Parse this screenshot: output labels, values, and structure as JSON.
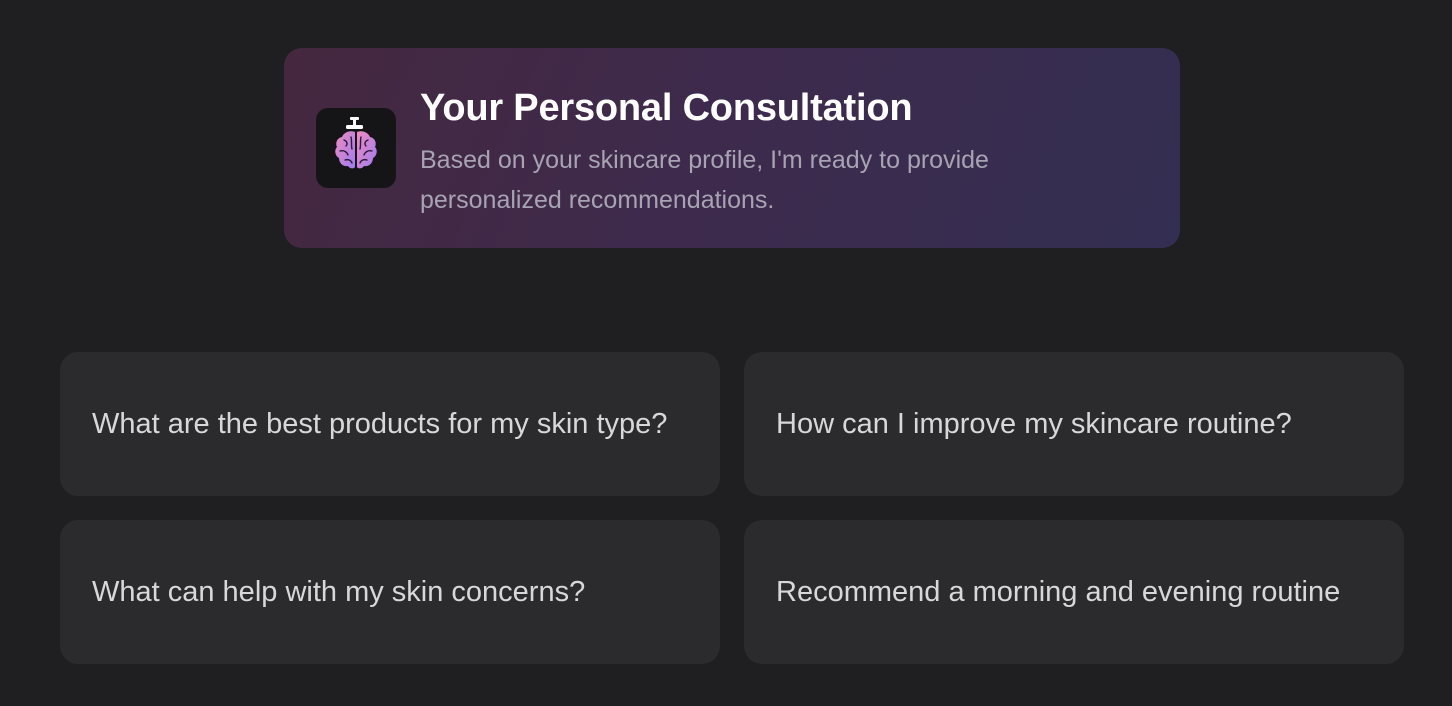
{
  "consultation": {
    "title": "Your Personal Consultation",
    "subtitle": "Based on your skincare profile, I'm ready to provide personalized recommendations.",
    "icon": "brain-dispenser-icon"
  },
  "suggestions": [
    {
      "label": "What are the best products for my skin type?"
    },
    {
      "label": "How can I improve my skincare routine?"
    },
    {
      "label": "What can help with my skin concerns?"
    },
    {
      "label": "Recommend a morning and evening routine"
    }
  ],
  "colors": {
    "background": "#1f1f21",
    "card": "#2b2b2e",
    "hero_gradient_start": "#45283f",
    "hero_gradient_end": "#332f52",
    "brain_pink": "#f08bc0",
    "brain_purple": "#9f7cf0"
  }
}
